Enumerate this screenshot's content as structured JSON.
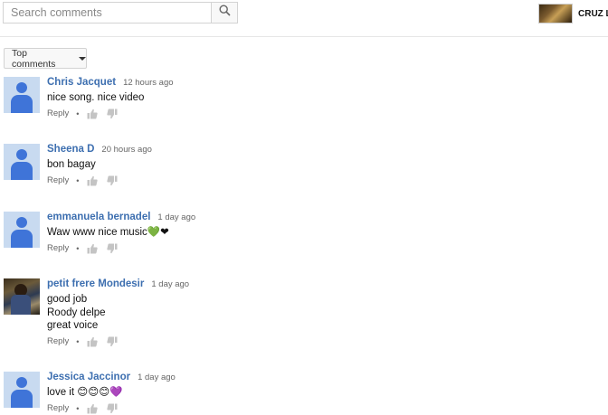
{
  "search": {
    "placeholder": "Search comments",
    "icon": "search-icon"
  },
  "channel": {
    "name": "CRUZ LA"
  },
  "sort": {
    "label": "Top comments"
  },
  "colors": {
    "author": "#3d6fb0",
    "avatar_bg": "#c8daf0",
    "avatar_fg": "#3f74d8"
  },
  "comments": [
    {
      "author": "Chris Jacquet",
      "time": "12 hours ago",
      "lines": [
        "nice song. nice video"
      ],
      "reply": "Reply",
      "avatar": "default"
    },
    {
      "author": "Sheena D",
      "time": "20 hours ago",
      "lines": [
        "bon bagay"
      ],
      "reply": "Reply",
      "avatar": "default"
    },
    {
      "author": "emmanuela bernadel",
      "time": "1 day ago",
      "lines": [
        "Waw www nice music"
      ],
      "emoji": [
        "💚",
        "❤"
      ],
      "reply": "Reply",
      "avatar": "default"
    },
    {
      "author": "petit frere Mondesir",
      "time": "1 day ago",
      "lines": [
        "good job",
        "Roody delpe",
        "great voice"
      ],
      "reply": "Reply",
      "avatar": "photo"
    },
    {
      "author": "Jessica Jaccinor",
      "time": "1 day ago",
      "lines": [
        "love it"
      ],
      "emoji": [
        "😊",
        "😊",
        "😊",
        "💜"
      ],
      "reply": "Reply",
      "avatar": "default"
    }
  ]
}
